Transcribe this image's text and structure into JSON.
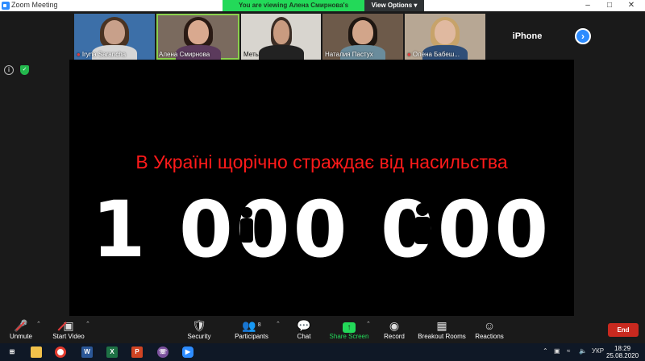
{
  "window": {
    "title": "Zoom Meeting",
    "viewing_banner": "You are viewing Алена Смирнова's screen",
    "view_options": "View Options"
  },
  "participants": [
    {
      "name": "Iryna Sarancha",
      "muted": true
    },
    {
      "name": "Алена Смирнова",
      "muted": false,
      "active": true
    },
    {
      "name": "Меть",
      "muted": false
    },
    {
      "name": "Наталия Пастух",
      "muted": false
    },
    {
      "name": "Олена Бабеш...",
      "muted": true
    },
    {
      "name": "iPhone",
      "muted": false
    }
  ],
  "shared_content": {
    "headline": "В Україні щорічно страждає від насильства",
    "big_number": "1 000 000",
    "headline_color": "#ff1a1a"
  },
  "toolbar": {
    "unmute": "Unmute",
    "start_video": "Start Video",
    "security": "Security",
    "participants": "Participants",
    "participants_count": "8",
    "chat": "Chat",
    "share_screen": "Share Screen",
    "record": "Record",
    "breakout_rooms": "Breakout Rooms",
    "reactions": "Reactions",
    "end": "End"
  },
  "taskbar": {
    "language": "УКР",
    "time": "18:29",
    "date": "25.08.2020",
    "apps": [
      "file-explorer",
      "chrome",
      "word",
      "excel",
      "powerpoint",
      "viber",
      "zoom"
    ]
  },
  "colors": {
    "zoom_blue": "#2d8cff",
    "banner_green": "#23d959",
    "end_red": "#c8291f"
  }
}
